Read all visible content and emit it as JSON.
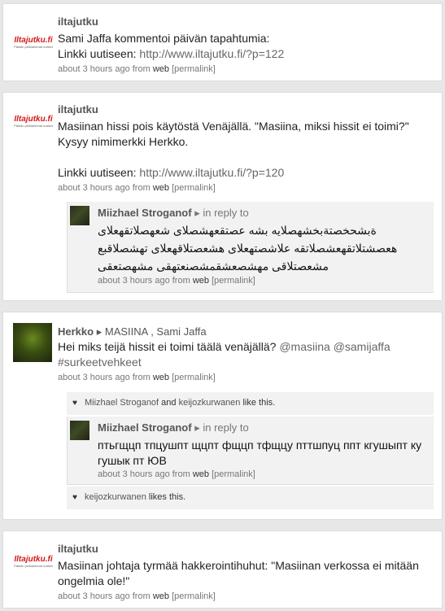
{
  "posts": [
    {
      "author": "iltajutku",
      "avatar_logo": "Iltajutku.fi",
      "avatar_tagline": "Pätsän pelkiaimmat uutiset",
      "lines": [
        "Sami Jaffa kommentoi päivän tapahtumia:"
      ],
      "link_prefix": "Linkki uutiseen: ",
      "link": "http://www.iltajutku.fi/?p=122",
      "time": "about 3 hours ago",
      "from": "from",
      "source": "web",
      "permalink": "[permalink]"
    },
    {
      "author": "iltajutku",
      "avatar_logo": "Iltajutku.fi",
      "avatar_tagline": "Pätsän pelkiaimmat uutiset",
      "lines": [
        "Masiinan hissi pois käytöstä Venäjällä. \"Masiina, miksi hissit ei toimi?\"",
        "Kysyy nimimerkki Herkko."
      ],
      "link_prefix": "Linkki uutiseen: ",
      "link": "http://www.iltajutku.fi/?p=120",
      "time": "about 3 hours ago",
      "from": "from",
      "source": "web",
      "permalink": "[permalink]",
      "reply": {
        "author": "Miizhael Stroganof",
        "arrow": "▸",
        "in_reply_to": "in reply to",
        "lines": [
          "ةبشحخصتةبخشهصلايه بشه عصتقعهشصلاى شعهصلاتقهعلاى",
          "هعصشتلاتقهعشصلاتقه علاشصتهعلاى هشعصتلاقهعلاى تهشصلاقبع",
          "مشعصتلاقى مهشصعشقمشصنعتهقى مشهصتعقى"
        ],
        "time": "about 3 hours ago",
        "from": "from",
        "source": "web",
        "permalink": "[permalink]"
      }
    },
    {
      "author": "Herkko",
      "arrow": "▸",
      "to": "MASIINA , Sami Jaffa",
      "text": "Hei miks teijä hissit ei toimi täälä venäjällä? ",
      "mention1": "@masiina",
      "mention2": "@samijaffa",
      "hashtag": "#surkeetvehkeet",
      "time": "about 3 hours ago",
      "from": "from",
      "source": "web",
      "permalink": "[permalink]",
      "likes": {
        "user1": "Miizhael Stroganof",
        "and": "and",
        "user2": "keijozkurwanen",
        "suffix": "like this."
      },
      "reply": {
        "author": "Miizhael Stroganof",
        "arrow": "▸",
        "in_reply_to": "in reply to",
        "lines": [
          "птьгщцп тпцушпт щцпт фщцп тфщцу пттшпуц ппт кгушыпт ку",
          "гушык пт ЮВ"
        ],
        "time": "about 3 hours ago",
        "from": "from",
        "source": "web",
        "permalink": "[permalink]"
      },
      "reply_likes": {
        "user1": "keijozkurwanen",
        "suffix": "likes this."
      }
    },
    {
      "author": "iltajutku",
      "avatar_logo": "Iltajutku.fi",
      "avatar_tagline": "Pätsän pelkiaimmat uutiset",
      "lines": [
        "Masiinan johtaja tyrmää hakkerointihuhut: \"Masiinan verkossa ei mitään",
        "ongelmia ole!\""
      ],
      "time": "about 3 hours ago",
      "from": "from",
      "source": "web",
      "permalink": "[permalink]"
    }
  ]
}
